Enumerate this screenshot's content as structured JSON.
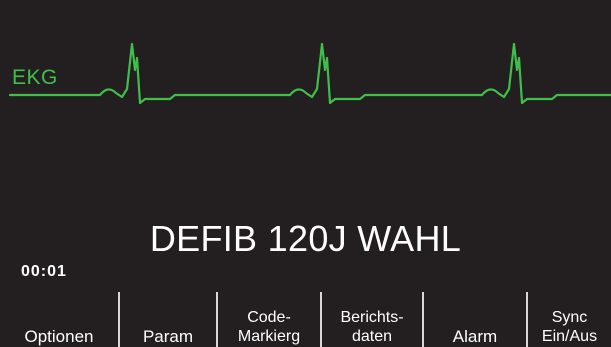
{
  "colors": {
    "background": "#231f20",
    "ekg_trace": "#3fbf4a",
    "text": "#ffffff",
    "divider": "#d8d8d8"
  },
  "ekg": {
    "label": "EKG"
  },
  "status": {
    "message": "DEFIB 120J WAHL"
  },
  "timer": {
    "elapsed": "00:01"
  },
  "softkeys": [
    {
      "line1": "",
      "line2": "Optionen"
    },
    {
      "line1": "",
      "line2": "Param"
    },
    {
      "line1": "Code-",
      "line2": "Markierg"
    },
    {
      "line1": "Berichts-",
      "line2": "daten"
    },
    {
      "line1": "",
      "line2": "Alarm"
    },
    {
      "line1": "Sync",
      "line2": "Ein/Aus"
    }
  ]
}
